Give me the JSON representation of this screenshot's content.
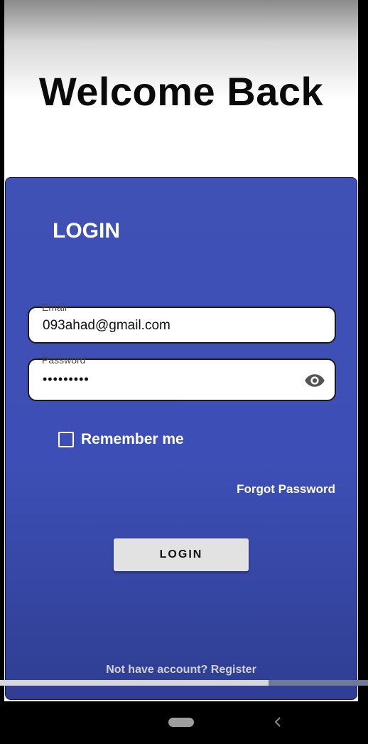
{
  "header": {
    "title": "Welcome Back"
  },
  "login_card": {
    "title": "LOGIN",
    "email": {
      "label": "Email",
      "value": "093ahad@gmail.com"
    },
    "password": {
      "label": "Password",
      "value": "•••••••••",
      "visibility_icon": "eye-icon"
    },
    "remember_me": {
      "label": "Remember me",
      "checked": false
    },
    "forgot_password": "Forgot Password",
    "login_button": "LOGIN",
    "register_link": "Not have account? Register"
  },
  "progress": {
    "fraction": 0.73
  },
  "system_nav": {
    "home_icon": "home-pill-icon",
    "back_icon": "back-arrow-icon"
  },
  "colors": {
    "card": "#3f51b5",
    "button": "#e2e2e2",
    "text_light": "#ffffff"
  }
}
